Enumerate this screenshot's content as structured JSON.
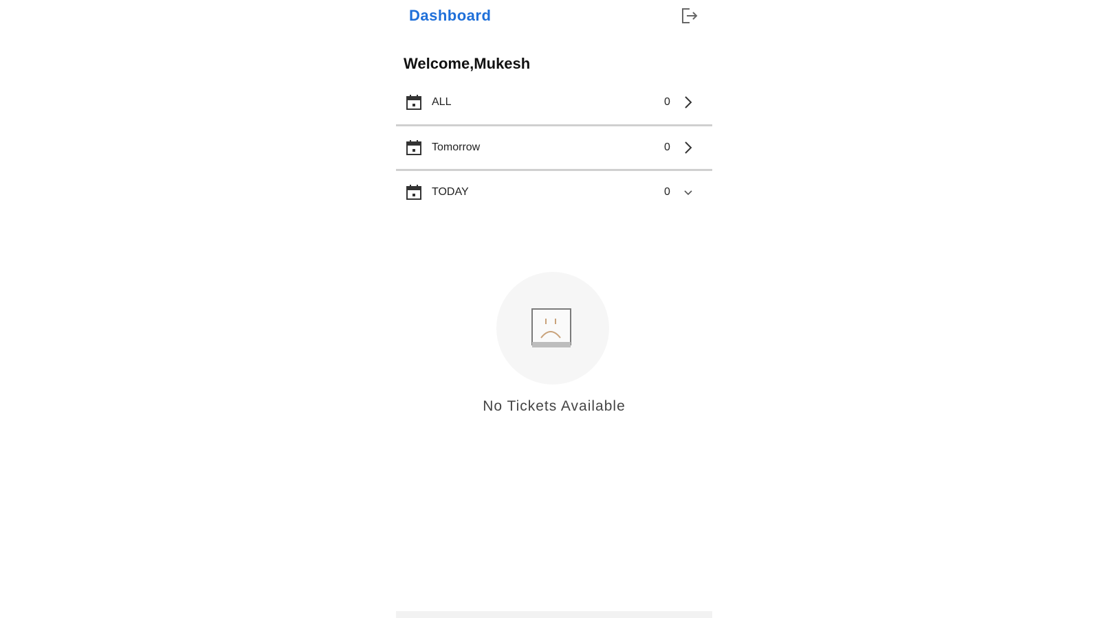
{
  "header": {
    "title": "Dashboard",
    "logout_icon": "logout-icon"
  },
  "welcome": "Welcome,Mukesh",
  "filters": [
    {
      "label": "ALL",
      "count": "0",
      "icon": "calendar-icon",
      "indicator": "chevron-right-icon"
    },
    {
      "label": "Tomorrow",
      "count": "0",
      "icon": "calendar-icon",
      "indicator": "chevron-right-icon"
    },
    {
      "label": "TODAY",
      "count": "0",
      "icon": "calendar-icon",
      "indicator": "chevron-down-icon"
    }
  ],
  "empty_state": {
    "message": "No Tickets Available",
    "icon": "sad-face-icon"
  },
  "colors": {
    "accent": "#1e6fd9",
    "divider": "#cfcfcf",
    "empty_bg": "#f6f6f6"
  }
}
